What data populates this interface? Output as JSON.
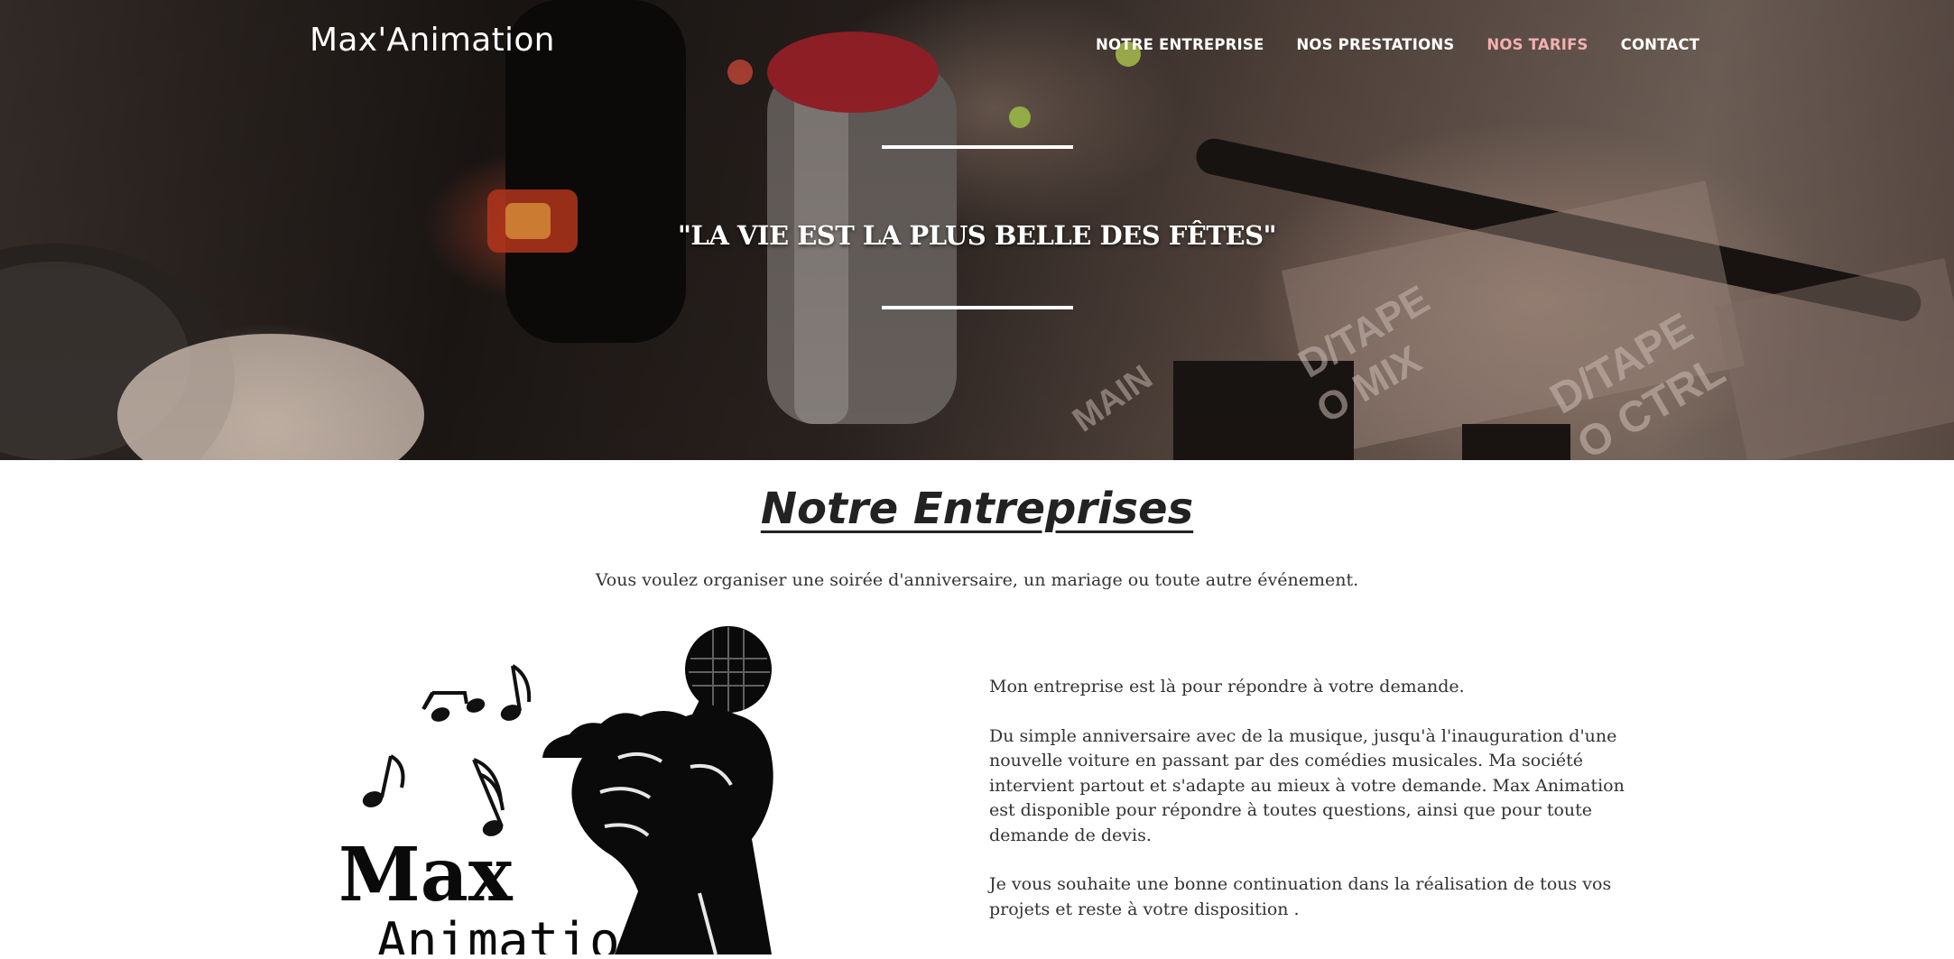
{
  "header": {
    "brand": "Max'Animation",
    "nav": [
      {
        "label": "NOTRE ENTREPRISE",
        "active": false
      },
      {
        "label": "NOS PRESTATIONS",
        "active": false
      },
      {
        "label": "NOS TARIFS",
        "active": true
      },
      {
        "label": "CONTACT",
        "active": false
      }
    ],
    "active_color": "#f3b0b2"
  },
  "hero": {
    "tagline": "\"LA VIE EST LA PLUS BELLE DES FÊTES\"",
    "background": "mixing-console-photo"
  },
  "section": {
    "title": "Notre Entreprises",
    "intro": "Vous voulez organiser une soirée d'anniversaire, un mariage ou toute autre événement.",
    "paragraphs": [
      "Mon entreprise est là pour répondre à votre demande.",
      "Du simple anniversaire avec de la musique, jusqu'à l'inauguration d'une nouvelle voiture en passant par des comédies musicales. Ma société intervient partout et s'adapte au mieux à votre demande. Max Animation est disponible pour répondre à toutes questions, ainsi que pour toute demande de devis.",
      "Je vous souhaite une bonne continuation dans la réalisation de tous vos projets et reste à votre disposition ."
    ]
  },
  "logo": {
    "line1": "Max",
    "line2": "Animation",
    "icons": [
      "microphone-icon",
      "music-notes-icon"
    ]
  }
}
